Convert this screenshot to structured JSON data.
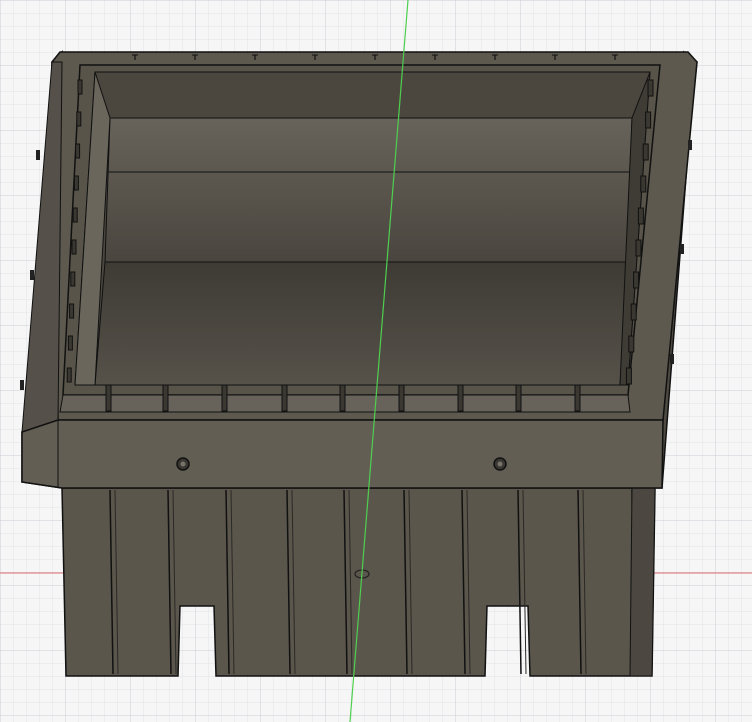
{
  "viewport": {
    "background": "#f6f6f6",
    "grid_minor_color": "#e1e4e8",
    "grid_major_color": "#c9ced6",
    "x_axis_color": "#e06b6b",
    "y_axis_color": "#4fcf4f"
  },
  "model": {
    "body_color": "#5c574c",
    "body_dark": "#46423a",
    "inner_light": "#6e6a5f",
    "inner_dark": "#3b3832",
    "edge_color": "#111111",
    "fastener_count_front": 2,
    "slot_count_front": 10,
    "leg_count": 10
  }
}
